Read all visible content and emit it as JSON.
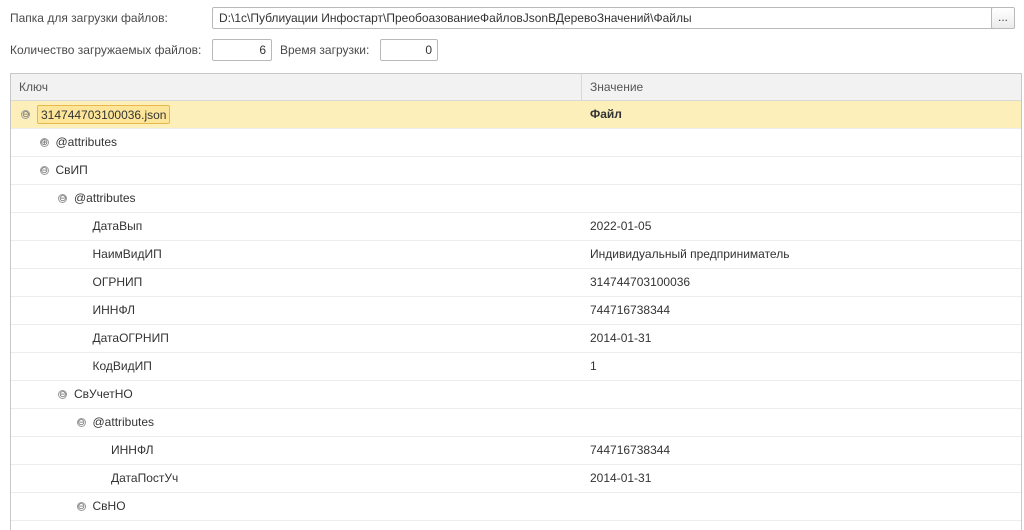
{
  "folder": {
    "label": "Папка для загрузки файлов:",
    "path": "D:\\1c\\Публиуации Инфостарт\\ПреобоазованиеФайловJsonВДеревоЗначений\\Файлы",
    "choose_label": "..."
  },
  "counts": {
    "files_label": "Количество загружаемых файлов:",
    "files_value": "6",
    "time_label": "Время загрузки:",
    "time_value": "0"
  },
  "tree": {
    "columns": {
      "key": "Ключ",
      "value": "Значение"
    },
    "rows": [
      {
        "key": "314744703100036.json",
        "value": "Файл",
        "toggle": "⊖",
        "level": 0,
        "selected": true
      },
      {
        "key": "@attributes",
        "value": "",
        "toggle": "⊕",
        "level": 1
      },
      {
        "key": "СвИП",
        "value": "",
        "toggle": "⊖",
        "level": 1
      },
      {
        "key": "@attributes",
        "value": "",
        "toggle": "⊖",
        "level": 2
      },
      {
        "key": "ДатаВып",
        "value": "2022-01-05",
        "toggle": "",
        "level": 3
      },
      {
        "key": "НаимВидИП",
        "value": "Индивидуальный предприниматель",
        "toggle": "",
        "level": 3
      },
      {
        "key": "ОГРНИП",
        "value": "314744703100036",
        "toggle": "",
        "level": 3
      },
      {
        "key": "ИННФЛ",
        "value": "744716738344",
        "toggle": "",
        "level": 3
      },
      {
        "key": "ДатаОГРНИП",
        "value": "2014-01-31",
        "toggle": "",
        "level": 3
      },
      {
        "key": "КодВидИП",
        "value": "1",
        "toggle": "",
        "level": 3
      },
      {
        "key": "СвУчетНО",
        "value": "",
        "toggle": "⊖",
        "level": 2
      },
      {
        "key": "@attributes",
        "value": "",
        "toggle": "⊖",
        "level": 3
      },
      {
        "key": "ИННФЛ",
        "value": "744716738344",
        "toggle": "",
        "level": 4
      },
      {
        "key": "ДатаПостУч",
        "value": "2014-01-31",
        "toggle": "",
        "level": 4
      },
      {
        "key": "СвНО",
        "value": "",
        "toggle": "⊖",
        "level": 3
      }
    ]
  }
}
